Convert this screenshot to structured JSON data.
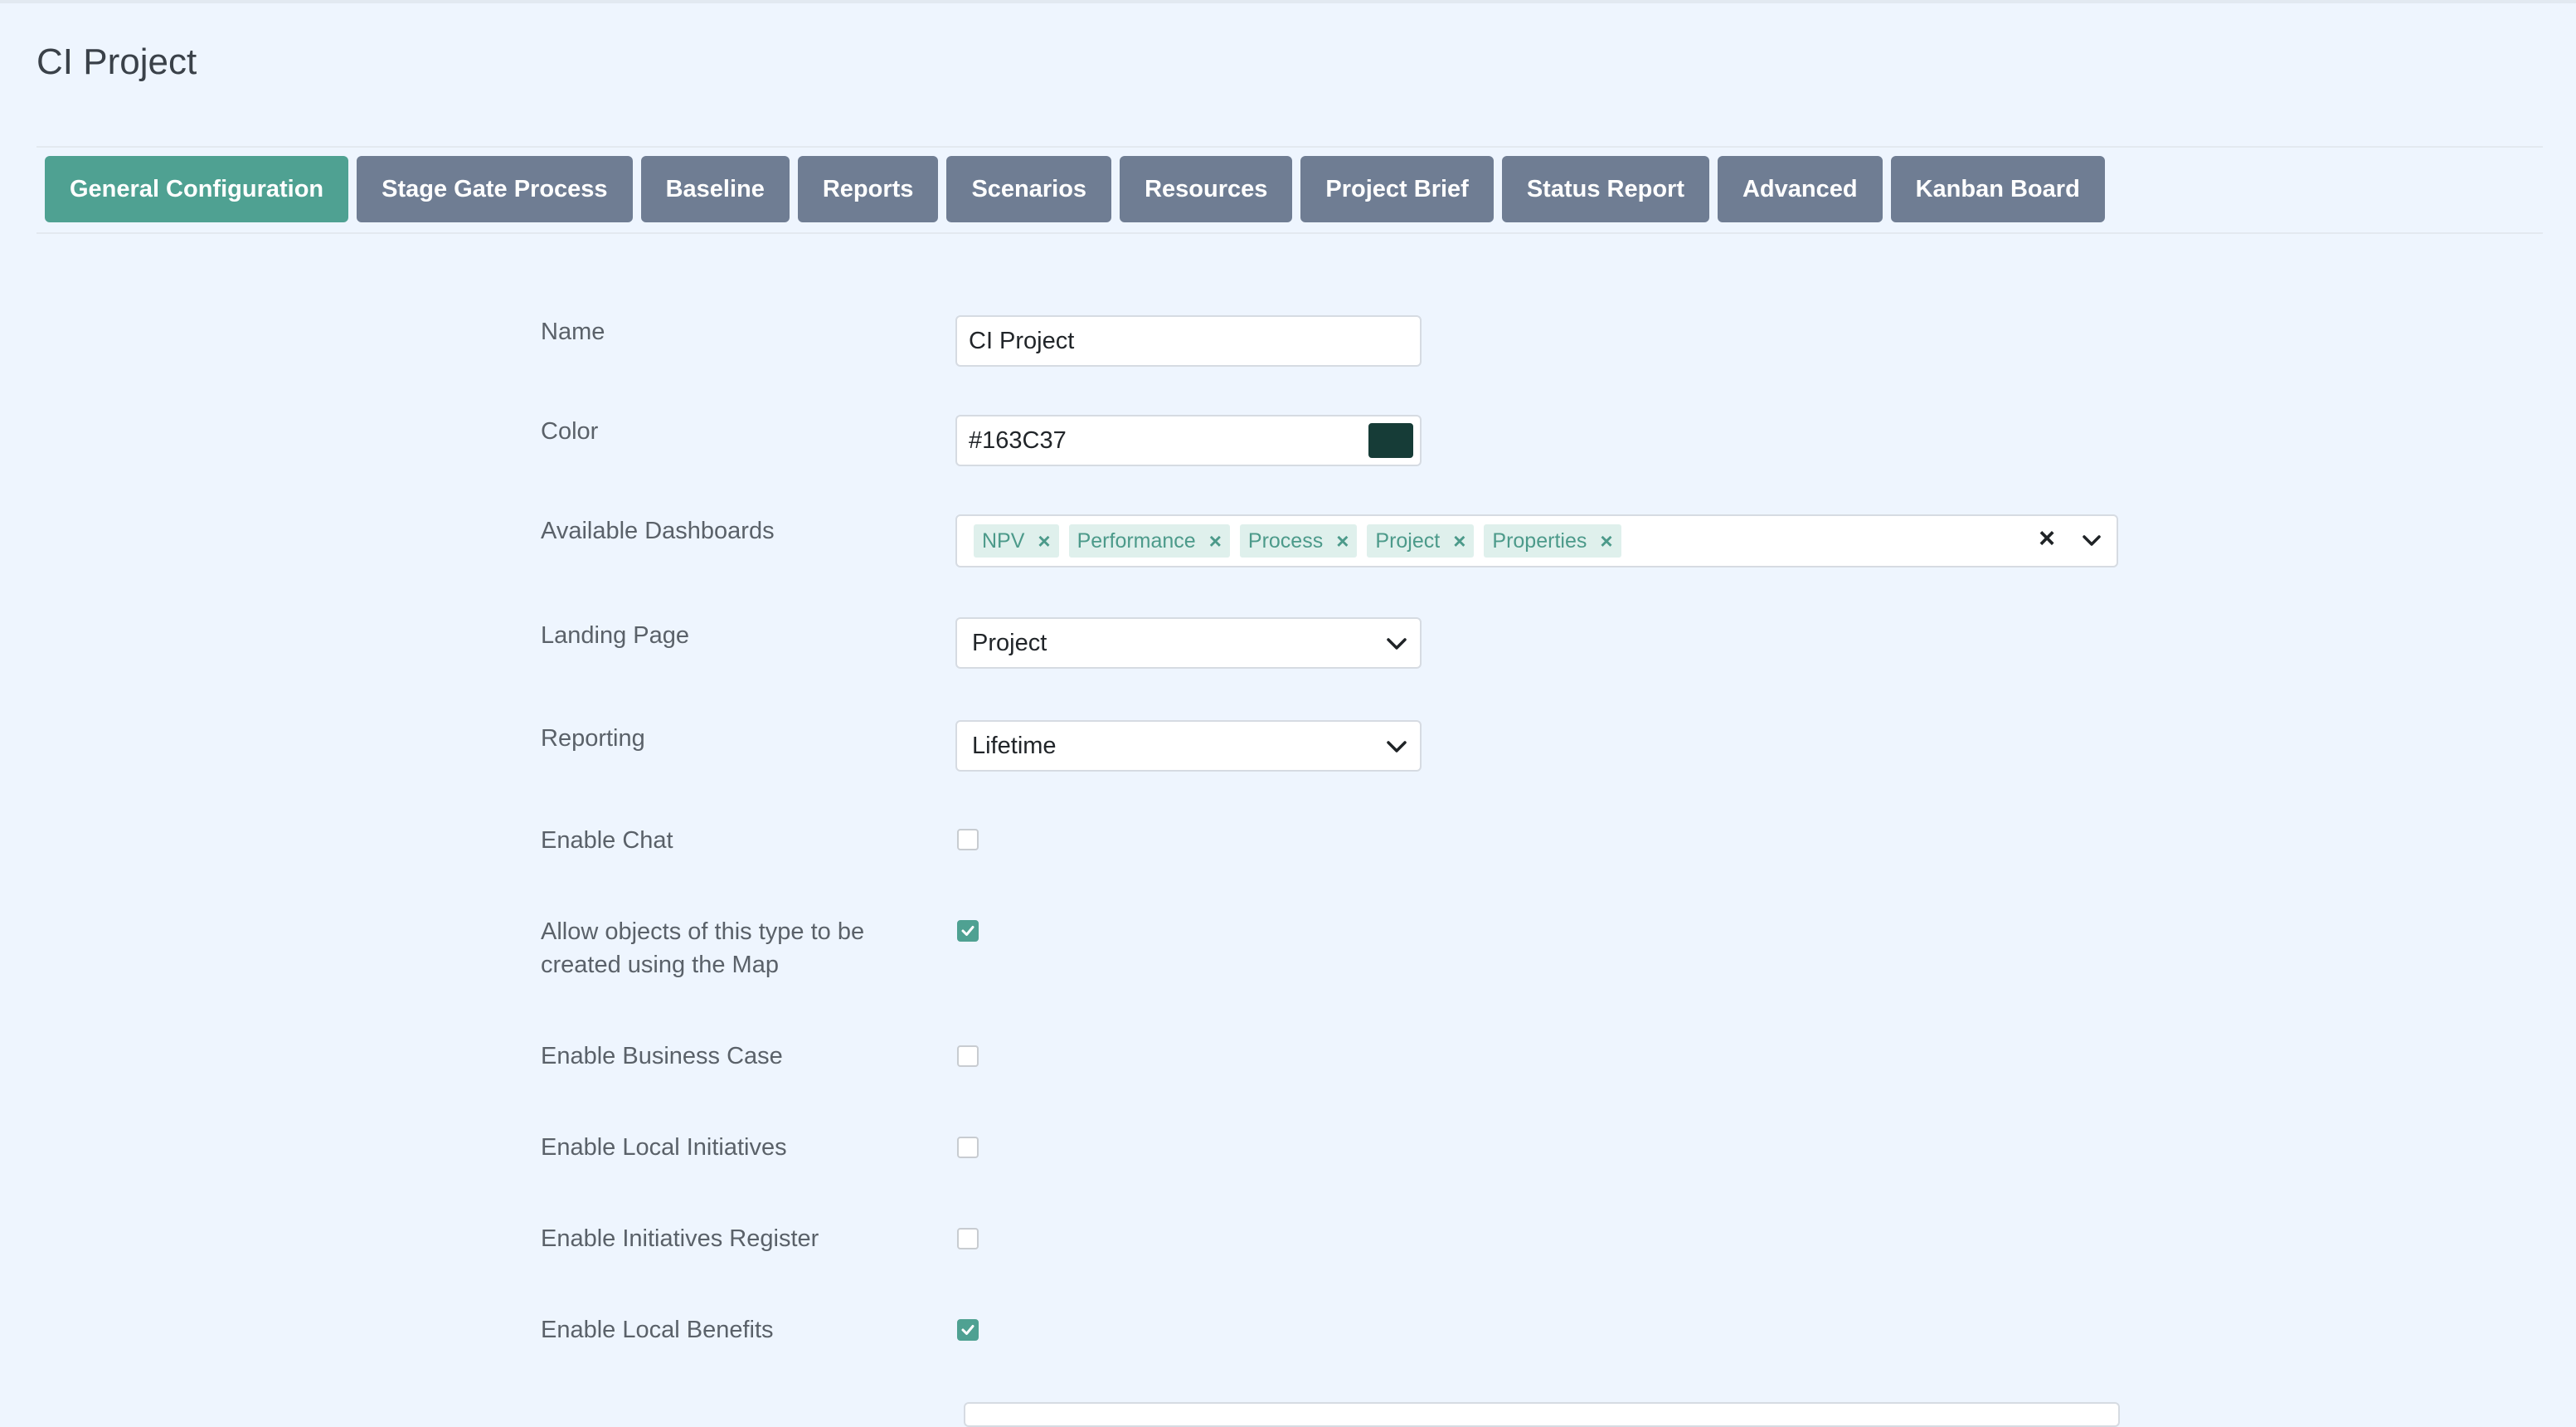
{
  "page": {
    "title": "CI Project"
  },
  "tabs": [
    {
      "label": "General Configuration",
      "active": true
    },
    {
      "label": "Stage Gate Process"
    },
    {
      "label": "Baseline"
    },
    {
      "label": "Reports"
    },
    {
      "label": "Scenarios"
    },
    {
      "label": "Resources"
    },
    {
      "label": "Project Brief"
    },
    {
      "label": "Status Report"
    },
    {
      "label": "Advanced"
    },
    {
      "label": "Kanban Board"
    }
  ],
  "form": {
    "name": {
      "label": "Name",
      "value": "CI Project"
    },
    "color": {
      "label": "Color",
      "value": "#163C37",
      "swatch": "#163C37"
    },
    "dashboards": {
      "label": "Available Dashboards",
      "chips": [
        "NPV",
        "Performance",
        "Process",
        "Project",
        "Properties"
      ],
      "chip_remove": "×",
      "clear_all": "×"
    },
    "landing_page": {
      "label": "Landing Page",
      "value": "Project"
    },
    "reporting": {
      "label": "Reporting",
      "value": "Lifetime"
    },
    "checkboxes": [
      {
        "label": "Enable Chat",
        "checked": false
      },
      {
        "label": "Allow objects of this type to be created using the Map",
        "checked": true
      },
      {
        "label": "Enable Business Case",
        "checked": false
      },
      {
        "label": "Enable Local Initiatives",
        "checked": false
      },
      {
        "label": "Enable Initiatives Register",
        "checked": false
      },
      {
        "label": "Enable Local Benefits",
        "checked": true
      }
    ]
  },
  "colors": {
    "accent": "#4fa192",
    "tab_inactive": "#6f7d93",
    "background": "#eef5fe"
  }
}
